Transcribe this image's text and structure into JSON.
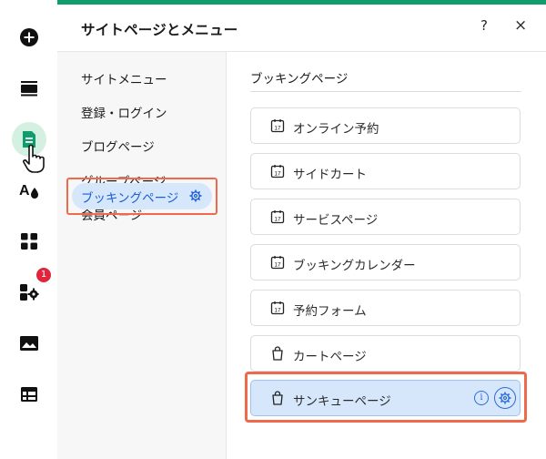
{
  "panel": {
    "title": "サイトページとメニュー",
    "help_label": "?",
    "close_label": "×"
  },
  "rail": {
    "notification_count": "1"
  },
  "nav": {
    "items": [
      {
        "label": "サイトメニュー"
      },
      {
        "label": "登録・ログイン"
      },
      {
        "label": "ブログページ"
      },
      {
        "label": "グループページ"
      },
      {
        "label": "会員ページ"
      }
    ],
    "selected": {
      "label": "ブッキングページ"
    }
  },
  "section": {
    "title": "ブッキングページ",
    "pages": [
      {
        "label": "オンライン予約",
        "icon": "calendar-icon"
      },
      {
        "label": "サイドカート",
        "icon": "calendar-icon"
      },
      {
        "label": "サービスページ",
        "icon": "calendar-icon"
      },
      {
        "label": "ブッキングカレンダー",
        "icon": "calendar-icon"
      },
      {
        "label": "予約フォーム",
        "icon": "calendar-icon"
      },
      {
        "label": "カートページ",
        "icon": "shopping-bag-icon"
      },
      {
        "label": "サンキューページ",
        "icon": "shopping-bag-icon",
        "selected": true
      }
    ],
    "calendar_day": "17",
    "info_label": "i"
  },
  "colors": {
    "accent_green": "#0f9d6e",
    "selected_blue": "#d6e7fc",
    "link_blue": "#1b5fd1",
    "highlight_orange": "#ef6a4d",
    "badge_red": "#e0263c"
  }
}
